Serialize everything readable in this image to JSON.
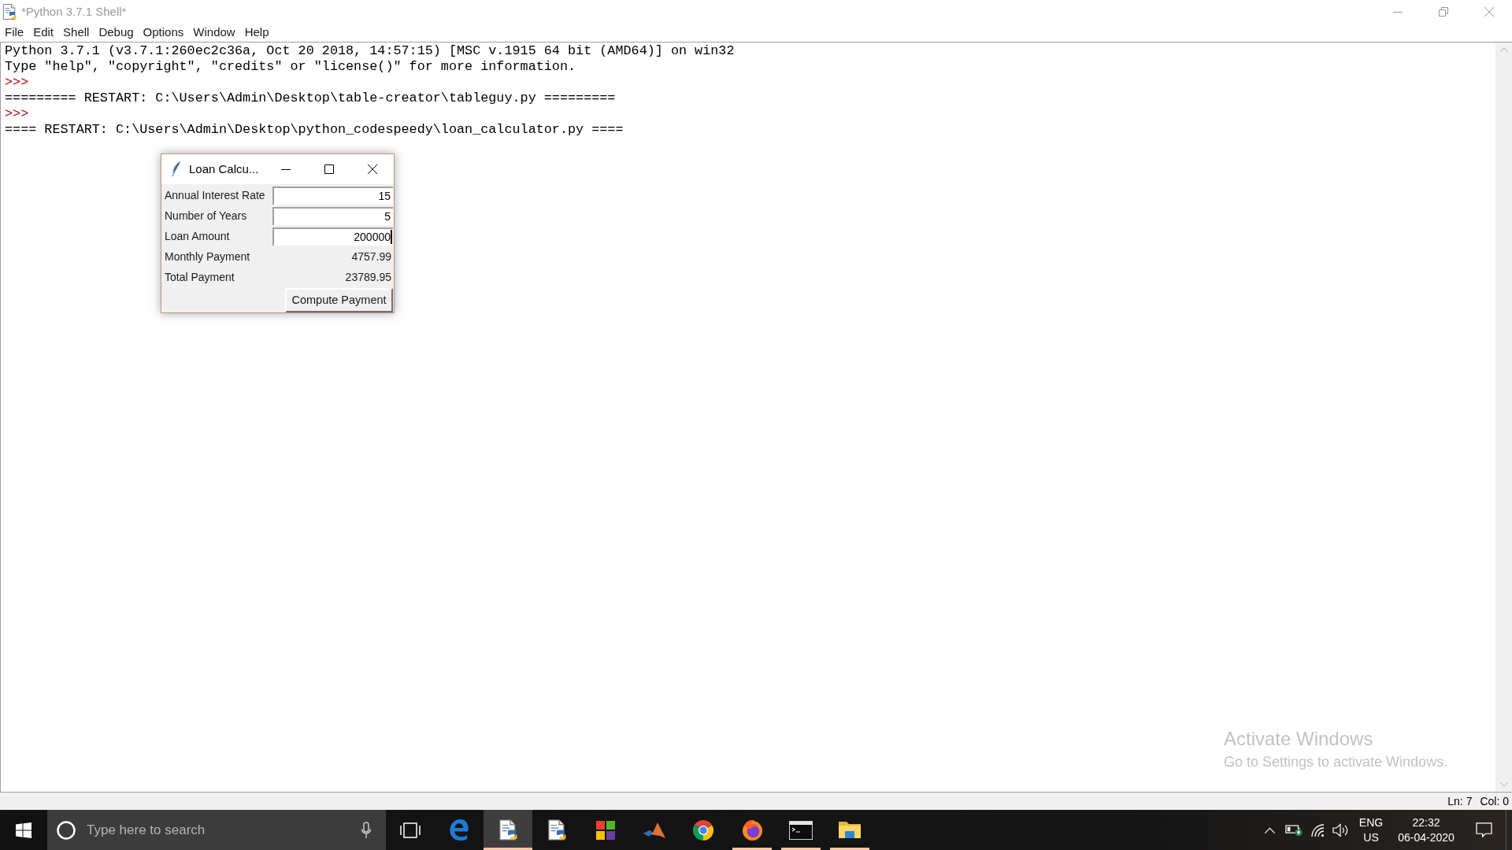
{
  "window": {
    "title": "*Python 3.7.1 Shell*"
  },
  "menu": [
    "File",
    "Edit",
    "Shell",
    "Debug",
    "Options",
    "Window",
    "Help"
  ],
  "shell": {
    "lines": [
      {
        "kind": "output",
        "text": "Python 3.7.1 (v3.7.1:260ec2c36a, Oct 20 2018, 14:57:15) [MSC v.1915 64 bit (AMD64)] on win32"
      },
      {
        "kind": "output",
        "text": "Type \"help\", \"copyright\", \"credits\" or \"license()\" for more information."
      },
      {
        "kind": "prompt",
        "text": ">>>"
      },
      {
        "kind": "output",
        "text": "========= RESTART: C:\\Users\\Admin\\Desktop\\table-creator\\tableguy.py ========="
      },
      {
        "kind": "prompt",
        "text": ">>>"
      },
      {
        "kind": "output",
        "text": "==== RESTART: C:\\Users\\Admin\\Desktop\\python_codespeedy\\loan_calculator.py ===="
      }
    ]
  },
  "dialog": {
    "title": "Loan Calcu...",
    "fields": [
      {
        "kind": "entry",
        "label": "Annual Interest Rate",
        "value": "15",
        "focused": false
      },
      {
        "kind": "entry",
        "label": "Number of Years",
        "value": "5",
        "focused": false
      },
      {
        "kind": "entry",
        "label": "Loan Amount",
        "value": "200000",
        "focused": true
      },
      {
        "kind": "result",
        "label": "Monthly Payment",
        "value": "4757.99"
      },
      {
        "kind": "result",
        "label": "Total Payment",
        "value": "23789.95"
      }
    ],
    "button": "Compute Payment"
  },
  "activation_notice": {
    "title": "Activate Windows",
    "text": "Go to Settings to activate Windows."
  },
  "status_bar": {
    "line": "Ln: 7",
    "column": "Col: 0"
  },
  "taskbar": {
    "search": {
      "placeholder": "Type here to search"
    },
    "apps": [
      {
        "kind": "swirl",
        "active": false,
        "running": false
      },
      {
        "kind": "script",
        "active": true,
        "running": true
      },
      {
        "kind": "script",
        "active": false,
        "running": false
      },
      {
        "kind": "tiles",
        "active": false,
        "running": false
      },
      {
        "kind": "peak",
        "active": false,
        "running": false
      },
      {
        "kind": "wheel",
        "active": false,
        "running": false
      },
      {
        "kind": "flame",
        "active": false,
        "running": true
      },
      {
        "kind": "console",
        "active": false,
        "running": true
      },
      {
        "kind": "folder",
        "active": false,
        "running": true
      }
    ],
    "tray": {
      "language": "ENG",
      "region": "US",
      "time": "22:32",
      "date": "06-04-2020"
    }
  }
}
